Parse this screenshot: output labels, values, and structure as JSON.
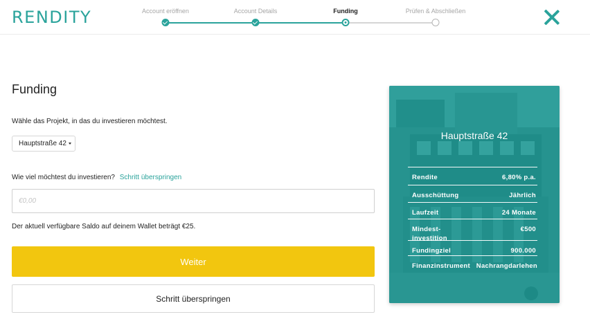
{
  "header": {
    "logo": "RENDITY",
    "steps": [
      {
        "label": "Account eröffnen",
        "state": "done"
      },
      {
        "label": "Account Details",
        "state": "done"
      },
      {
        "label": "Funding",
        "state": "current"
      },
      {
        "label": "Prüfen & Abschließen",
        "state": "todo"
      }
    ]
  },
  "form": {
    "title": "Funding",
    "project_question": "Wähle das Projekt, in das du investieren möchtest.",
    "project_selected": "Hauptstraße 42",
    "amount_question": "Wie viel möchtest du investieren?",
    "amount_skip_link": "Schritt überspringen",
    "amount_placeholder": "€0,00",
    "amount_value": "",
    "saldo_text": "Der aktuell verfügbare Saldo auf deinem Wallet beträgt €25.",
    "continue_label": "Weiter",
    "skip_label": "Schritt überspringen"
  },
  "card": {
    "title": "Hauptstraße 42",
    "facts": [
      {
        "label": "Rendite",
        "value": "6,80% p.a."
      },
      {
        "label": "Ausschüttung",
        "value": "Jährlich"
      },
      {
        "label": "Laufzeit",
        "value": "24 Monate"
      },
      {
        "label": "Mindest-investition",
        "value": "€500"
      },
      {
        "label": "Fundingziel",
        "value": "900.000"
      },
      {
        "label": "Finanzinstrument",
        "value": "Nachrangdarlehen"
      }
    ]
  },
  "colors": {
    "brand": "#2aa39b",
    "primary_button": "#f2c60f",
    "card_overlay": "#169e98"
  }
}
